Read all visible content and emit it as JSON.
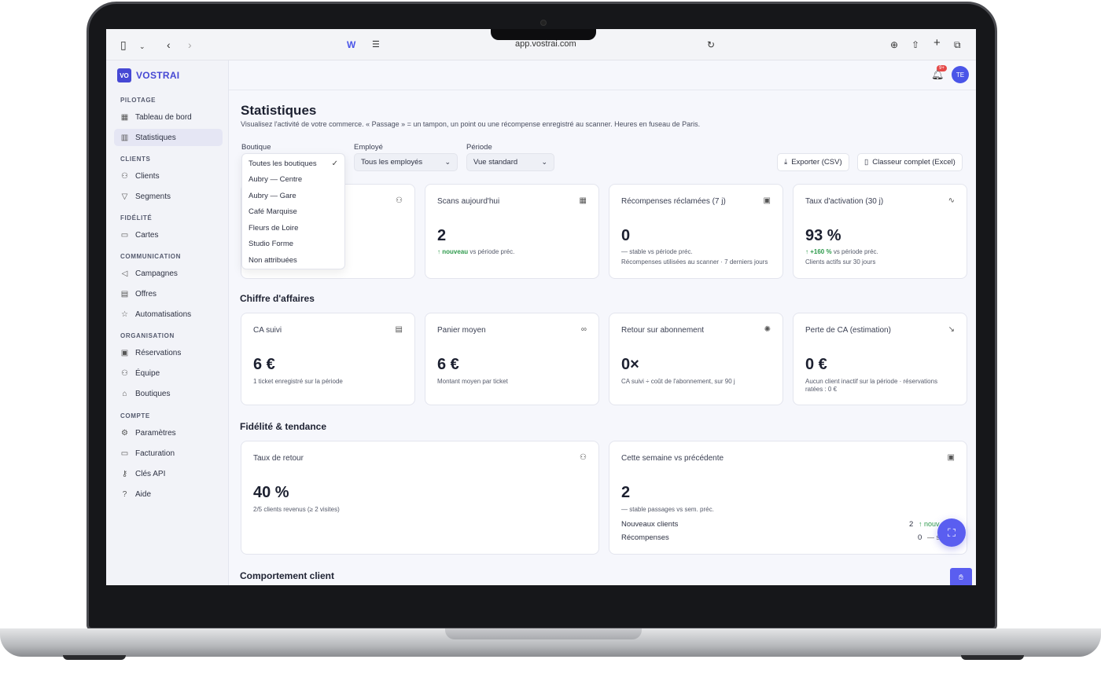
{
  "browser": {
    "url": "app.vostrai.com"
  },
  "brand": {
    "badge": "VO",
    "name": "VOSTRAI"
  },
  "header": {
    "notifications": "9+",
    "avatar": "TE"
  },
  "sidebar": {
    "sections": [
      "PILOTAGE",
      "CLIENTS",
      "FIDÉLITÉ",
      "COMMUNICATION",
      "ORGANISATION",
      "COMPTE"
    ],
    "items": [
      {
        "label": "Tableau de bord",
        "icon": "dashboard-icon"
      },
      {
        "label": "Statistiques",
        "icon": "chart-icon"
      },
      {
        "label": "Clients",
        "icon": "users-icon"
      },
      {
        "label": "Segments",
        "icon": "filter-icon"
      },
      {
        "label": "Cartes",
        "icon": "card-icon"
      },
      {
        "label": "Campagnes",
        "icon": "megaphone-icon"
      },
      {
        "label": "Offres",
        "icon": "ticket-icon"
      },
      {
        "label": "Automatisations",
        "icon": "star-icon"
      },
      {
        "label": "Réservations",
        "icon": "calendar-icon"
      },
      {
        "label": "Équipe",
        "icon": "team-icon"
      },
      {
        "label": "Boutiques",
        "icon": "store-icon"
      },
      {
        "label": "Paramètres",
        "icon": "gear-icon"
      },
      {
        "label": "Facturation",
        "icon": "billing-icon"
      },
      {
        "label": "Clés API",
        "icon": "key-icon"
      },
      {
        "label": "Aide",
        "icon": "help-icon"
      }
    ]
  },
  "page": {
    "title": "Statistiques",
    "subtitle": "Visualisez l'activité de votre commerce. « Passage » = un tampon, un point ou une récompense enregistré au scanner. Heures en fuseau de Paris."
  },
  "filters": {
    "boutique_label": "Boutique",
    "employe_label": "Employé",
    "periode_label": "Période",
    "employe_value": "Tous les employés",
    "periode_value": "Vue standard",
    "export_csv": "Exporter (CSV)",
    "export_excel": "Classeur complet (Excel)",
    "boutique_options": [
      "Toutes les boutiques",
      "Aubry — Centre",
      "Aubry — Gare",
      "Café Marquise",
      "Fleurs de Loire",
      "Studio Forme",
      "Non attribuées"
    ]
  },
  "kpis": {
    "scans": {
      "title": "Scans aujourd'hui",
      "value": "2",
      "trend": "nouveau",
      "trend_suffix": "vs période préc."
    },
    "rewards": {
      "title": "Récompenses réclamées (7 j)",
      "value": "0",
      "trend": "— stable vs période préc.",
      "note": "Récompenses utilisées au scanner · 7 derniers jours"
    },
    "activation": {
      "title": "Taux d'activation (30 j)",
      "value": "93 %",
      "trend": "+160 %",
      "trend_suffix": "vs période préc.",
      "note": "Clients actifs sur 30 jours"
    }
  },
  "revenue": {
    "section": "Chiffre d'affaires",
    "ca": {
      "title": "CA suivi",
      "value": "6 €",
      "note": "1 ticket enregistré sur la période"
    },
    "basket": {
      "title": "Panier moyen",
      "value": "6 €",
      "note": "Montant moyen par ticket"
    },
    "roi": {
      "title": "Retour sur abonnement",
      "value": "0×",
      "note": "CA suivi ÷ coût de l'abonnement, sur 90 j"
    },
    "loss": {
      "title": "Perte de CA (estimation)",
      "value": "0 €",
      "note1": "Aucun client inactif sur la période · réservations",
      "note2": "ratées : 0 €"
    }
  },
  "loyalty": {
    "section": "Fidélité & tendance",
    "retention": {
      "title": "Taux de retour",
      "value": "40 %",
      "note": "2/5 clients revenus (≥ 2 visites)"
    },
    "week": {
      "title": "Cette semaine vs précédente",
      "value": "2",
      "note": "— stable passages vs sem. préc.",
      "new_clients_label": "Nouveaux clients",
      "new_clients_value": "2",
      "new_clients_trend": "↑ nouv",
      "rewards_label": "Récompenses",
      "rewards_value": "0",
      "rewards_trend": "— st"
    }
  },
  "behavior": {
    "section": "Comportement client"
  }
}
